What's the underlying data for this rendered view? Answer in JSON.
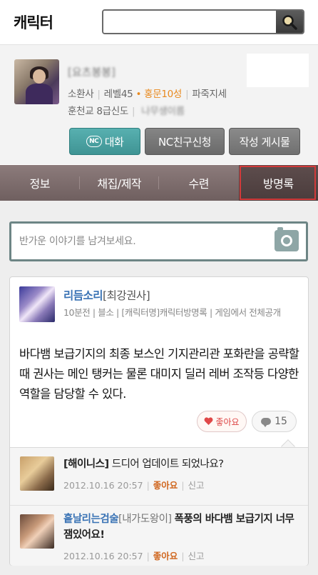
{
  "header": {
    "title": "캐릭터",
    "search": {
      "placeholder": "",
      "value": "",
      "button": "search-icon"
    }
  },
  "profile": {
    "name": "[요츠봉봉]",
    "class": "소환사",
    "level": "레벨45",
    "honor": "홍문10성",
    "faction": "파죽지세",
    "guild_rank": "훈천교 8급신도",
    "guild_member": "나무생이름",
    "buttons": {
      "chat_badge": "NC",
      "chat": "대화",
      "friend": "NC친구신청",
      "posts": "작성 게시물"
    }
  },
  "tabs": [
    {
      "label": "정보",
      "active": false
    },
    {
      "label": "채집/제작",
      "active": false
    },
    {
      "label": "수련",
      "active": false
    },
    {
      "label": "방명록",
      "active": true
    }
  ],
  "guestbook": {
    "write_placeholder": "반가운 이야기를 남겨보세요.",
    "post": {
      "author": "리듬소리",
      "author_tag": "[최강권사]",
      "meta": "10분전 | 블소 | [캐릭터명]캐릭터방명록 | 게임에서 전체공개",
      "body": "바다뱀 보급기지의 최종 보스인 기지관리관 포화란을 공략할 때 권사는 메인 탱커는 물론 대미지 딜러 레버 조작등 다양한 역할을 담당할 수 있다.",
      "like_label": "좋아요",
      "comment_count": "15"
    },
    "comments": [
      {
        "author": "[해이니스]",
        "author_tag": "",
        "text": "드디어 업데이트 되었나요?",
        "date": "2012.10.16 20:57",
        "like": "좋아요",
        "report": "신고"
      },
      {
        "author": "흩날리는검술",
        "author_tag": "[내가도왕이]",
        "text": "폭풍의 바다뱀 보급기지 너무 잼있어요!",
        "date": "2012.10.16 20:57",
        "like": "좋아요",
        "report": "신고"
      }
    ]
  },
  "colors": {
    "tab_bar": "#7d6c6c",
    "active_tab_frame": "#d23a3a",
    "chat_button": "#4aa3a3",
    "link_blue": "#3a73b5",
    "honor_orange": "#e8891e"
  }
}
